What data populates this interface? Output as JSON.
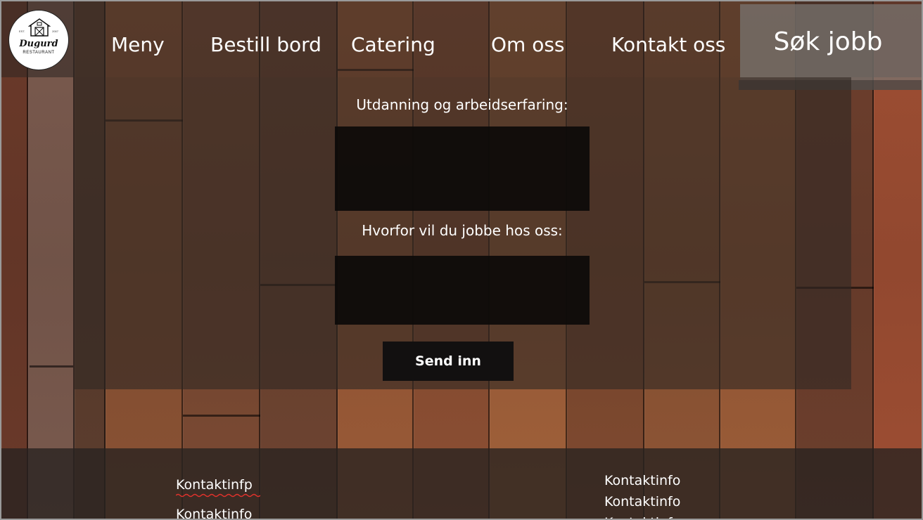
{
  "logo": {
    "name": "Dugurd",
    "subtitle": "RESTAURANT",
    "est": "EST.",
    "year": "2007"
  },
  "nav": {
    "items": [
      "Meny",
      "Bestill bord",
      "Catering",
      "Om oss",
      "Kontakt oss"
    ],
    "active": "Søk jobb"
  },
  "form": {
    "field1_label": "Utdanning og arbeidserfaring:",
    "field1_value": "",
    "field2_label": "Hvorfor vil du jobbe hos oss:",
    "field2_value": "",
    "submit_label": "Send inn"
  },
  "footer": {
    "left": [
      "Kontaktinfp",
      "Kontaktinfo"
    ],
    "right": [
      "Kontaktinfo",
      "Kontaktinfo",
      "Kontaktinfo"
    ]
  },
  "colors": {
    "text": "#ffffff",
    "field_bg": "#0c0a09",
    "button_bg": "#121010",
    "active_tab": "#78746f"
  }
}
